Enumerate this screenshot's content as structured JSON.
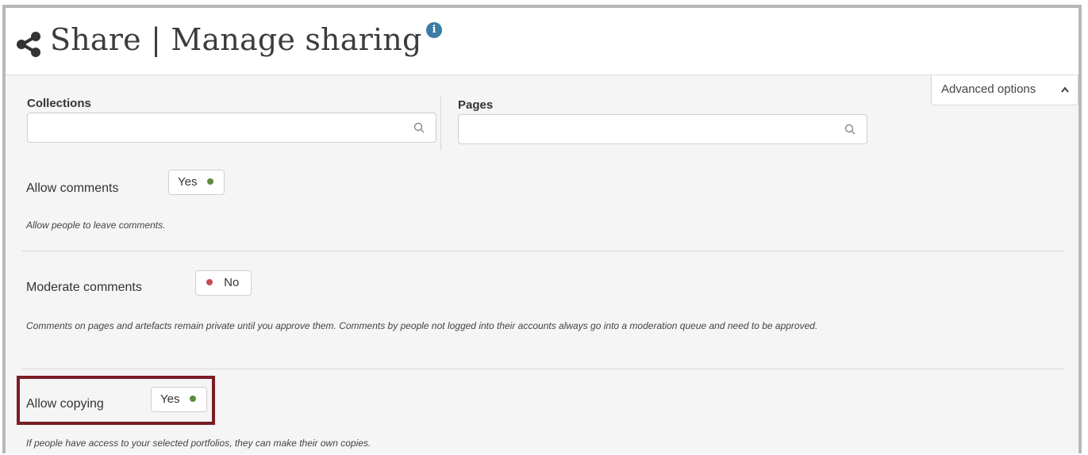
{
  "header": {
    "title": "Share | Manage sharing",
    "share_icon": "share-icon",
    "info_icon": "info-icon",
    "info_glyph": "i"
  },
  "advanced_options": {
    "label": "Advanced options",
    "icon": "chevron-up-icon"
  },
  "collections": {
    "label": "Collections",
    "value": "",
    "placeholder": ""
  },
  "pages": {
    "label": "Pages",
    "value": "",
    "placeholder": ""
  },
  "settings": {
    "allow_comments": {
      "label": "Allow comments",
      "state": "Yes",
      "description": "Allow people to leave comments."
    },
    "moderate_comments": {
      "label": "Moderate comments",
      "state": "No",
      "description": "Comments on pages and artefacts remain private until you approve them. Comments by people not logged into their accounts always go into a moderation queue and need to be approved."
    },
    "allow_copying": {
      "label": "Allow copying",
      "state": "Yes",
      "description": "If people have access to your selected portfolios, they can make their own copies."
    }
  },
  "colors": {
    "yes_dot": "#5b8c3a",
    "no_dot": "#c0504d",
    "highlight_border": "#7b1c25",
    "info_badge": "#3a7ca5"
  }
}
